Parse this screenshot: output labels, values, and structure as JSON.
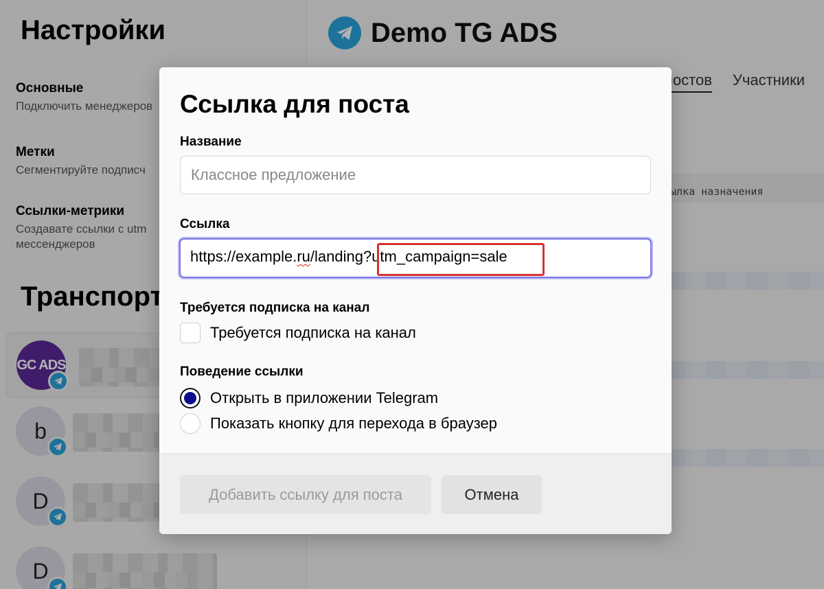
{
  "sidebar": {
    "title": "Настройки",
    "items": [
      {
        "title": "Основные",
        "desc": "Подключить менеджеров"
      },
      {
        "title": "Метки",
        "desc": "Сегментируйте подписч"
      },
      {
        "title": "Ссылки-метрики",
        "desc": "Создавате ссылки с utm мессенджеров"
      }
    ],
    "section_title": "Транспорт",
    "channels": [
      {
        "avatar_text": "GC ADS"
      },
      {
        "avatar_text": "b"
      },
      {
        "avatar_text": "D"
      },
      {
        "avatar_text": "D"
      }
    ]
  },
  "main": {
    "title": "Demo TG ADS",
    "tabs": [
      "постов",
      "Участники"
    ],
    "column_header": "ылка назначения"
  },
  "dialog": {
    "title": "Ссылка для поста",
    "name_label": "Название",
    "name_placeholder": "Классное предложение",
    "link_label": "Ссылка",
    "link_value": {
      "part1": "https://example.",
      "part2": "ru",
      "part3": "/landing",
      "part4": "?utm_campaign=sale"
    },
    "subscription_label": "Требуется подписка на канал",
    "subscription_checkbox_label": "Требуется подписка на канал",
    "subscription_checked": false,
    "behavior_label": "Поведение ссылки",
    "behavior_options": [
      {
        "label": "Открыть в приложении Telegram",
        "selected": true
      },
      {
        "label": "Показать кнопку для перехода в браузер",
        "selected": false
      }
    ],
    "add_button": "Добавить ссылку для поста",
    "cancel_button": "Отмена"
  },
  "colors": {
    "accent_focus": "#7b77e8",
    "radio_selected": "#0e0e8c",
    "highlight": "#d9302f",
    "telegram": "#2aa4dc"
  }
}
